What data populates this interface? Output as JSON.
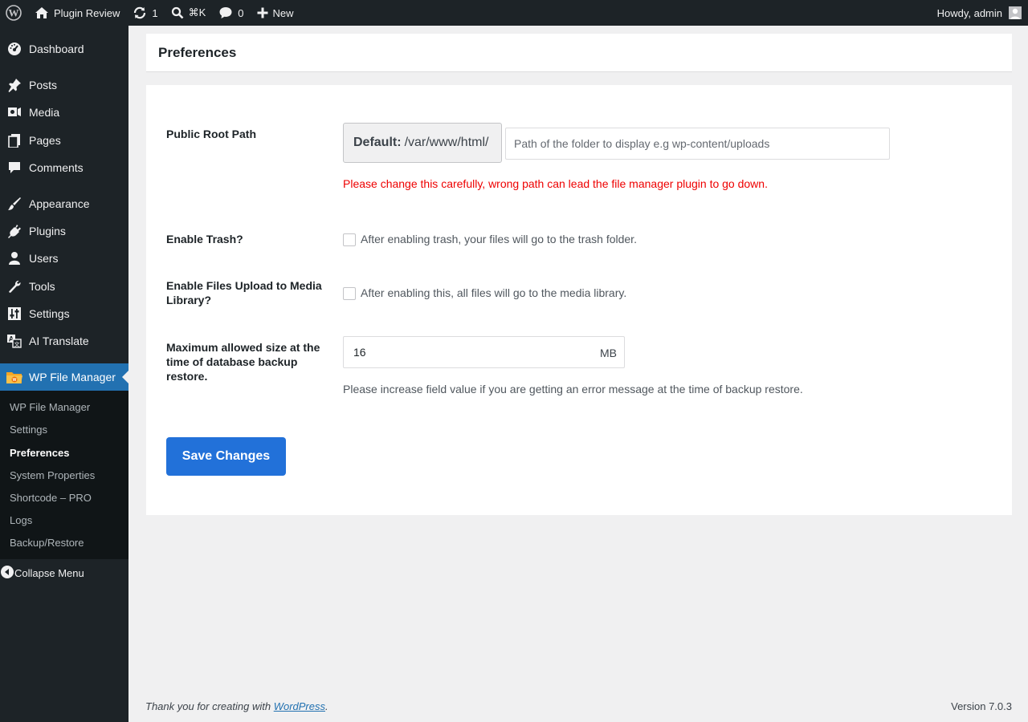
{
  "adminbar": {
    "site_name": "Plugin Review",
    "updates_count": "1",
    "search_shortcut": "⌘K",
    "comments_count": "0",
    "new_label": "New",
    "greeting": "Howdy, admin"
  },
  "sidebar": {
    "items": [
      {
        "label": "Dashboard"
      },
      {
        "label": "Posts"
      },
      {
        "label": "Media"
      },
      {
        "label": "Pages"
      },
      {
        "label": "Comments"
      },
      {
        "label": "Appearance"
      },
      {
        "label": "Plugins"
      },
      {
        "label": "Users"
      },
      {
        "label": "Tools"
      },
      {
        "label": "Settings"
      },
      {
        "label": "AI Translate"
      },
      {
        "label": "WP File Manager"
      }
    ],
    "submenu": [
      {
        "label": "WP File Manager"
      },
      {
        "label": "Settings"
      },
      {
        "label": "Preferences"
      },
      {
        "label": "System Properties"
      },
      {
        "label": "Shortcode – PRO"
      },
      {
        "label": "Logs"
      },
      {
        "label": "Backup/Restore"
      }
    ],
    "collapse_label": "Collapse Menu"
  },
  "page": {
    "title": "Preferences"
  },
  "form": {
    "root_path": {
      "label": "Public Root Path",
      "default_label": "Default:",
      "default_value": "/var/www/html/",
      "placeholder": "Path of the folder to display e.g wp-content/uploads",
      "value": "",
      "warning": "Please change this carefully, wrong path can lead the file manager plugin to go down."
    },
    "trash": {
      "label": "Enable Trash?",
      "description": "After enabling trash, your files will go to the trash folder.",
      "checked": false
    },
    "media_upload": {
      "label": "Enable Files Upload to Media Library?",
      "description": "After enabling this, all files will go to the media library.",
      "checked": false
    },
    "max_size": {
      "label": "Maximum allowed size at the time of database backup restore.",
      "value": "16",
      "unit": "MB",
      "hint": "Please increase field value if you are getting an error message at the time of backup restore."
    },
    "save_label": "Save Changes"
  },
  "footer": {
    "thanks_text": "Thank you for creating with",
    "link_text": "WordPress",
    "period": ".",
    "version": "Version 7.0.3"
  },
  "colors": {
    "admin_dark": "#1d2327",
    "submenu_dark": "#101517",
    "accent_blue": "#2271b1",
    "button_blue": "#2271d9",
    "warning_red": "#ee0000"
  }
}
